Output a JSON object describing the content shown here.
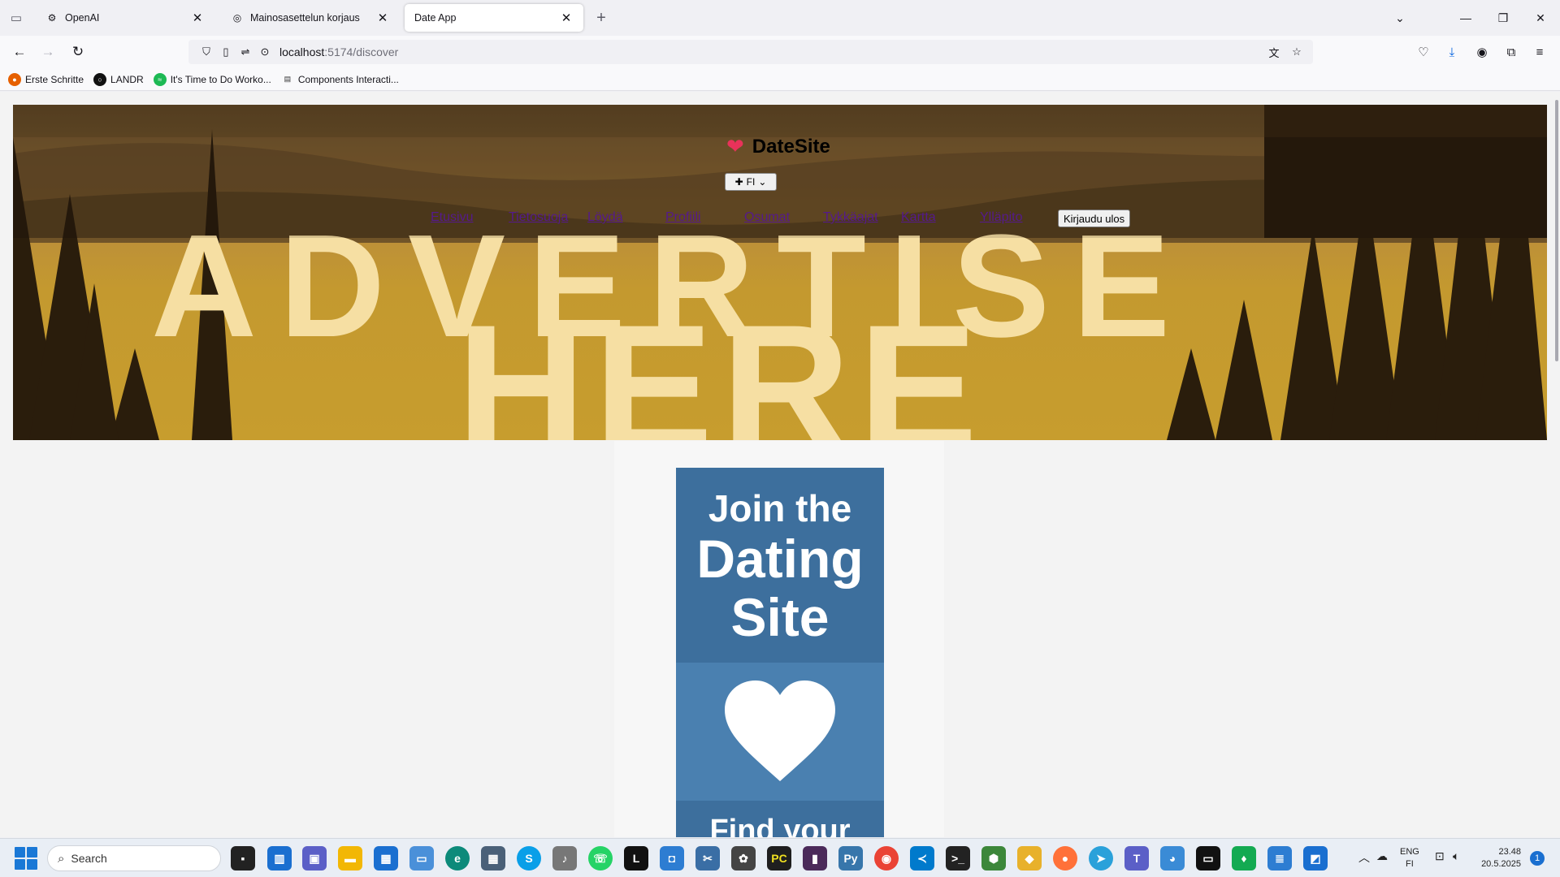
{
  "browser": {
    "tabs": [
      {
        "title": "OpenAI",
        "icon": "openai-icon"
      },
      {
        "title": "Mainosasettelun korjaus",
        "icon": "chatgpt-icon"
      },
      {
        "title": "Date App",
        "icon": "blank-page-icon"
      }
    ],
    "url_host": "localhost",
    "url_path": ":5174/discover",
    "bookmarks": [
      {
        "label": "Erste Schritte",
        "color": "#e66000"
      },
      {
        "label": "LANDR",
        "color": "#111111"
      },
      {
        "label": "It's Time to Do Worko...",
        "color": "#1db954"
      },
      {
        "label": "Components Interacti...",
        "color": "#444444"
      }
    ]
  },
  "site": {
    "brand": "DateSite",
    "language": "FI",
    "nav": [
      "Etusivu",
      "Tietosuoja",
      "Löydä",
      "Profiili",
      "Osumat",
      "Tykkäajat",
      "Kartta",
      "Ylläpito"
    ],
    "logout": "Kirjaudu ulos",
    "hero_word_top": "ADVERTISE",
    "hero_word": "HERE",
    "ad": {
      "line1": "Join the",
      "line2": "Dating",
      "line3": "Site",
      "line4": "Find your"
    }
  },
  "taskbar": {
    "search_placeholder": "Search",
    "lang_top": "ENG",
    "lang_bottom": "FI",
    "time": "23.48",
    "date": "20.5.2025",
    "notifications": "1"
  },
  "colors": {
    "brand_heart": "#e8325a",
    "ad_blue": "#3d6f9d",
    "ad_blue_light": "#4a80b0",
    "visited_link": "#551a8b"
  }
}
